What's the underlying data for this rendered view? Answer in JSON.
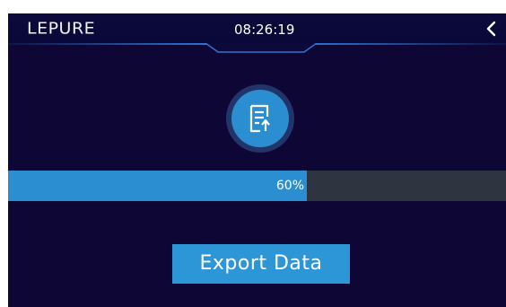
{
  "header": {
    "logo": "LEPURE",
    "time": "08:26:19",
    "back_icon": "chevron-left-icon"
  },
  "export": {
    "icon": "document-upload-icon",
    "progress_fraction": 0.6,
    "progress_label": "60%",
    "button_label": "Export Data"
  },
  "colors": {
    "background": "#0e0635",
    "header": "#0c0a3c",
    "accent": "#2d96d6",
    "progress_fill": "#2b8ed0",
    "progress_track": "#2e3440",
    "icon_circle": "#2b8ed0"
  }
}
